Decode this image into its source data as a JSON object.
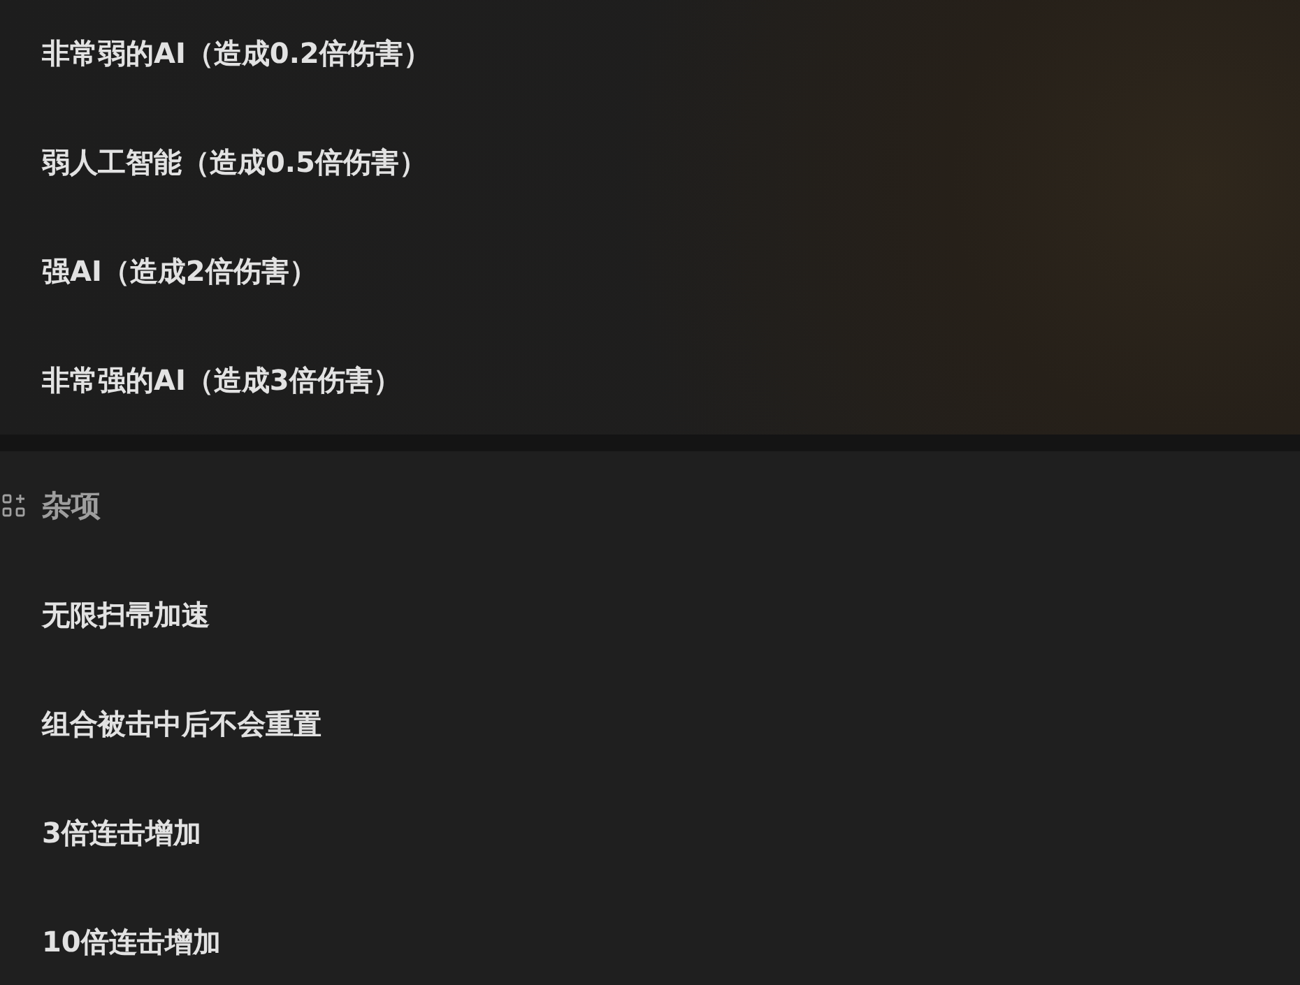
{
  "sections": [
    {
      "items": [
        "非常弱的AI（造成0.2倍伤害）",
        "弱人工智能（造成0.5倍伤害）",
        "强AI（造成2倍伤害）",
        "非常强的AI（造成3倍伤害）"
      ]
    },
    {
      "title": "杂项",
      "items": [
        "无限扫帚加速",
        "组合被击中后不会重置",
        "3倍连击增加",
        "10倍连击增加"
      ]
    }
  ]
}
